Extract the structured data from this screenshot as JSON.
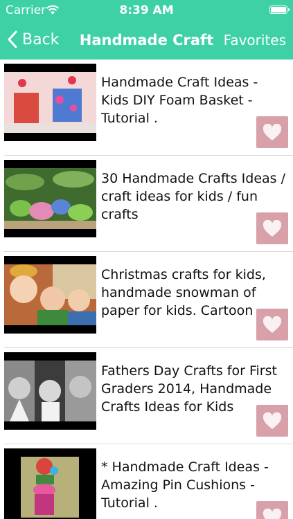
{
  "status": {
    "carrier": "Carrier",
    "time": "8:39 AM"
  },
  "nav": {
    "back_label": "Back",
    "title": "Handmade Craft",
    "favorites_label": "Favorites"
  },
  "items": [
    {
      "title": "Handmade Craft Ideas - Kids DIY Foam Basket - Tutorial ."
    },
    {
      "title": "30 Handmade Crafts Ideas / craft ideas for kids / fun crafts"
    },
    {
      "title": "Christmas crafts for kids, handmade snowman of paper for kids. Cartoon videos, crafts..."
    },
    {
      "title": "Fathers Day Crafts for First Graders 2014, Handmade Crafts Ideas for Kids"
    },
    {
      "title": "* Handmade Craft Ideas - Amazing Pin Cushions - Tutorial ."
    }
  ],
  "colors": {
    "accent": "#3fd1a6",
    "fav_button": "#d8a0a9"
  },
  "icons": {
    "back": "chevron-left-icon",
    "wifi": "wifi-icon",
    "battery": "battery-icon",
    "favorite": "heart-icon"
  }
}
